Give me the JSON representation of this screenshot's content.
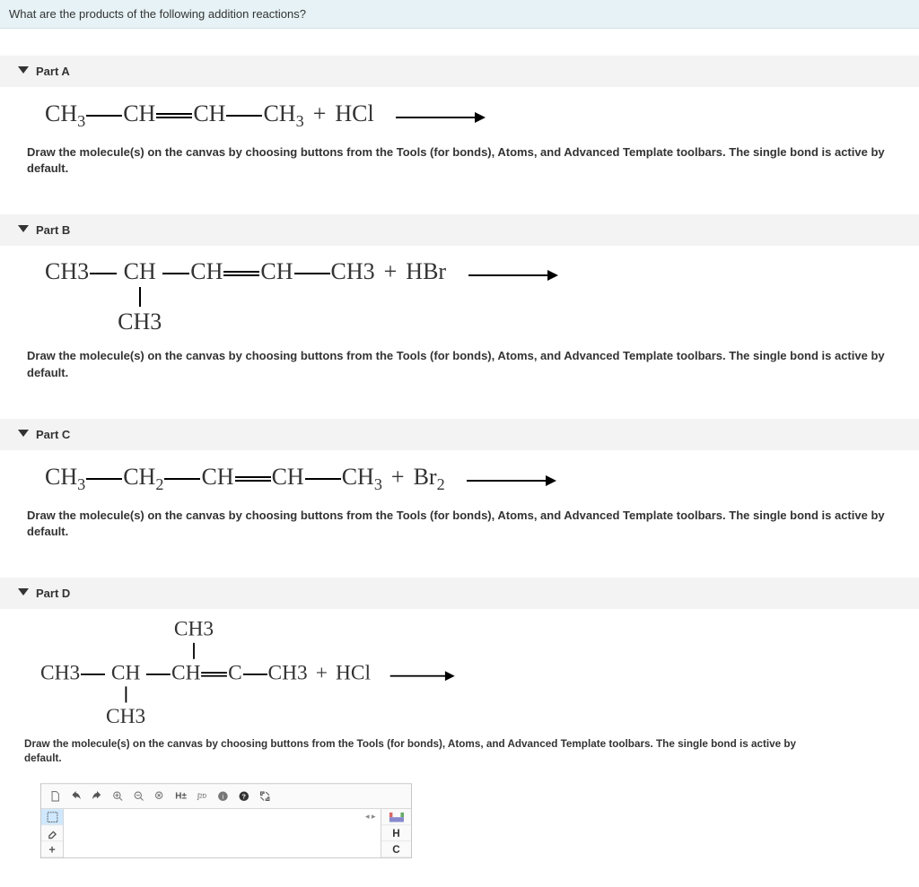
{
  "question": "What are the products of the following addition reactions?",
  "instruction": "Draw the molecule(s) on the canvas by choosing buttons from the Tools (for bonds), Atoms, and Advanced Template toolbars. The single bond is active by default.",
  "parts": {
    "a": {
      "title": "Part A"
    },
    "b": {
      "title": "Part B"
    },
    "c": {
      "title": "Part C"
    },
    "d": {
      "title": "Part D"
    }
  },
  "chem": {
    "CH3": "CH",
    "CH3_sub": "3",
    "CH2": "CH",
    "CH2_sub": "2",
    "CH": "CH",
    "C": "C",
    "HCl": "HCl",
    "HBr": "HBr",
    "Br2": "Br",
    "Br2_sub": "2",
    "plus": "+"
  },
  "editor": {
    "toolbar": {
      "new": "new-document",
      "undo": "undo",
      "redo": "redo",
      "zoom_in": "zoom-in",
      "zoom_out": "zoom-out",
      "zoom_fit": "zoom-fit",
      "hplus": "H±",
      "view2d": "2D",
      "info": "info",
      "help": "?",
      "fullscreen": "fullscreen"
    },
    "left": {
      "marquee": "marquee-select",
      "erase": "erase",
      "plus": "+"
    },
    "right": {
      "periodic": "periodic-table",
      "H": "H",
      "C": "C"
    },
    "corner": "◂ ▸"
  }
}
